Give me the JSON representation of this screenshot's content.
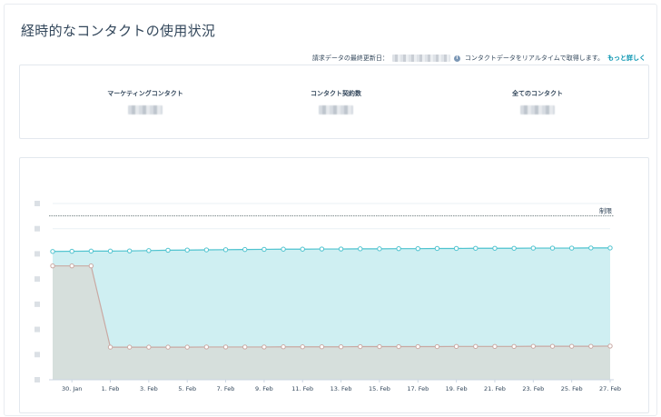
{
  "page": {
    "title": "経時的なコンタクトの使用状況"
  },
  "meta": {
    "billing_label": "請求データの最終更新日：",
    "billing_value": "",
    "realtime_note": "コンタクトデータをリアルタイムで取得します。",
    "learn_more": "もっと詳しく",
    "info_icon": "info-icon"
  },
  "stats": [
    {
      "label": "マーケティングコンタクト",
      "value": ""
    },
    {
      "label": "コンタクト契約数",
      "value": ""
    },
    {
      "label": "全てのコンタクト",
      "value": ""
    }
  ],
  "chart_data": {
    "type": "area",
    "x_tick_labels": [
      "30. Jan",
      "1. Feb",
      "3. Feb",
      "5. Feb",
      "7. Feb",
      "9. Feb",
      "11. Feb",
      "13. Feb",
      "15. Feb",
      "17. Feb",
      "19. Feb",
      "21. Feb",
      "23. Feb",
      "25. Feb",
      "27. Feb"
    ],
    "limit_label": "制限",
    "y_tick_labels_redacted": true,
    "y_gridlines": 8,
    "limit_level": 0.93,
    "series": [
      {
        "color": "#4fc3cf",
        "fill": "#cfeff2",
        "values": [
          0.728,
          0.729,
          0.73,
          0.73,
          0.731,
          0.733,
          0.735,
          0.736,
          0.737,
          0.738,
          0.739,
          0.74,
          0.741,
          0.741,
          0.742,
          0.742,
          0.743,
          0.743,
          0.744,
          0.744,
          0.745,
          0.745,
          0.746,
          0.746,
          0.746,
          0.747,
          0.747,
          0.747,
          0.748,
          0.748
        ]
      },
      {
        "color": "#c9a9a3",
        "fill": "#d6dfdc",
        "values": [
          0.646,
          0.646,
          0.646,
          0.185,
          0.185,
          0.185,
          0.185,
          0.185,
          0.186,
          0.186,
          0.186,
          0.186,
          0.187,
          0.187,
          0.187,
          0.187,
          0.188,
          0.188,
          0.188,
          0.188,
          0.188,
          0.189,
          0.189,
          0.189,
          0.189,
          0.19,
          0.19,
          0.19,
          0.19,
          0.191
        ]
      }
    ],
    "grid": true,
    "legend": "none"
  }
}
